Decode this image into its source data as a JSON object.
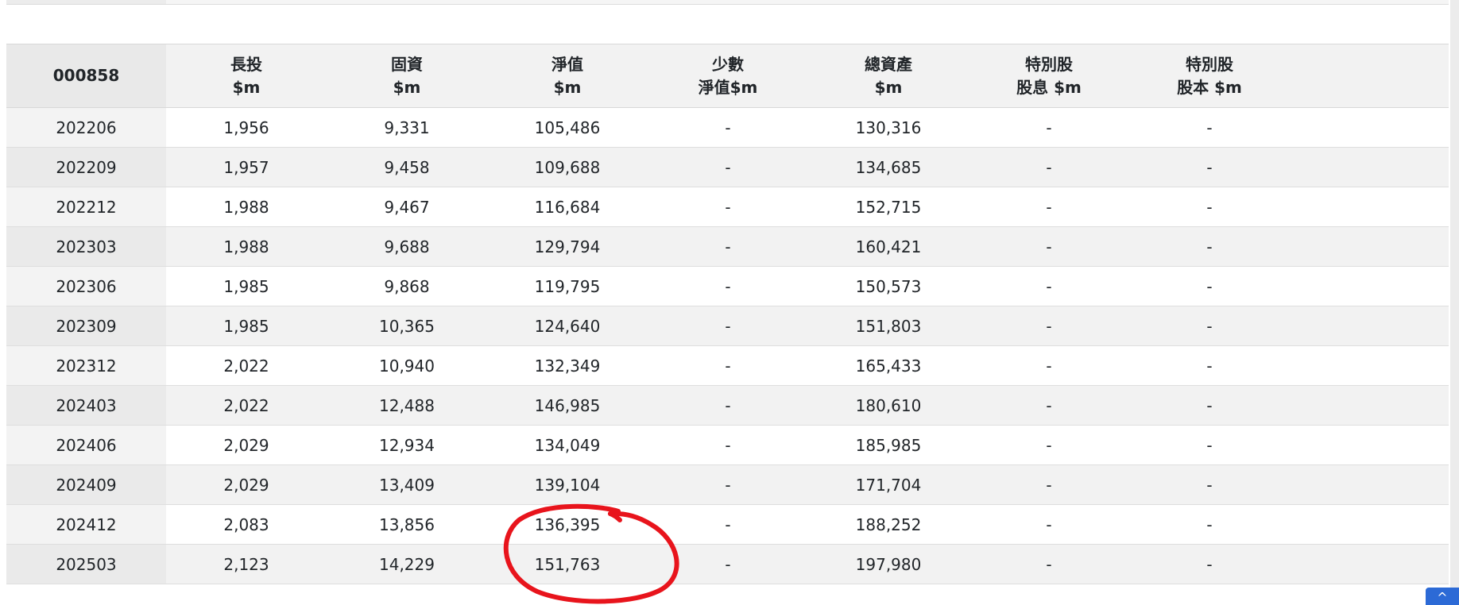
{
  "table": {
    "code": "000858",
    "headers": [
      {
        "line1": "長投",
        "line2": "$m"
      },
      {
        "line1": "固資",
        "line2": "$m"
      },
      {
        "line1": "淨值",
        "line2": "$m"
      },
      {
        "line1": "少數",
        "line2": "淨值$m"
      },
      {
        "line1": "總資產",
        "line2": "$m"
      },
      {
        "line1": "特別股",
        "line2": "股息 $m"
      },
      {
        "line1": "特別股",
        "line2": "股本 $m"
      }
    ],
    "rows": [
      {
        "period": "202206",
        "cells": [
          "1,956",
          "9,331",
          "105,486",
          "-",
          "130,316",
          "-",
          "-"
        ]
      },
      {
        "period": "202209",
        "cells": [
          "1,957",
          "9,458",
          "109,688",
          "-",
          "134,685",
          "-",
          "-"
        ]
      },
      {
        "period": "202212",
        "cells": [
          "1,988",
          "9,467",
          "116,684",
          "-",
          "152,715",
          "-",
          "-"
        ]
      },
      {
        "period": "202303",
        "cells": [
          "1,988",
          "9,688",
          "129,794",
          "-",
          "160,421",
          "-",
          "-"
        ]
      },
      {
        "period": "202306",
        "cells": [
          "1,985",
          "9,868",
          "119,795",
          "-",
          "150,573",
          "-",
          "-"
        ]
      },
      {
        "period": "202309",
        "cells": [
          "1,985",
          "10,365",
          "124,640",
          "-",
          "151,803",
          "-",
          "-"
        ]
      },
      {
        "period": "202312",
        "cells": [
          "2,022",
          "10,940",
          "132,349",
          "-",
          "165,433",
          "-",
          "-"
        ]
      },
      {
        "period": "202403",
        "cells": [
          "2,022",
          "12,488",
          "146,985",
          "-",
          "180,610",
          "-",
          "-"
        ]
      },
      {
        "period": "202406",
        "cells": [
          "2,029",
          "12,934",
          "134,049",
          "-",
          "185,985",
          "-",
          "-"
        ]
      },
      {
        "period": "202409",
        "cells": [
          "2,029",
          "13,409",
          "139,104",
          "-",
          "171,704",
          "-",
          "-"
        ]
      },
      {
        "period": "202412",
        "cells": [
          "2,083",
          "13,856",
          "136,395",
          "-",
          "188,252",
          "-",
          "-"
        ]
      },
      {
        "period": "202503",
        "cells": [
          "2,123",
          "14,229",
          "151,763",
          "-",
          "197,980",
          "-",
          "-"
        ]
      }
    ]
  },
  "annotation": {
    "color": "#e8141c",
    "shape": "hand-drawn circle"
  },
  "scroll_top": {
    "icon": "chevron-up-icon",
    "color": "#2c6ad6"
  }
}
